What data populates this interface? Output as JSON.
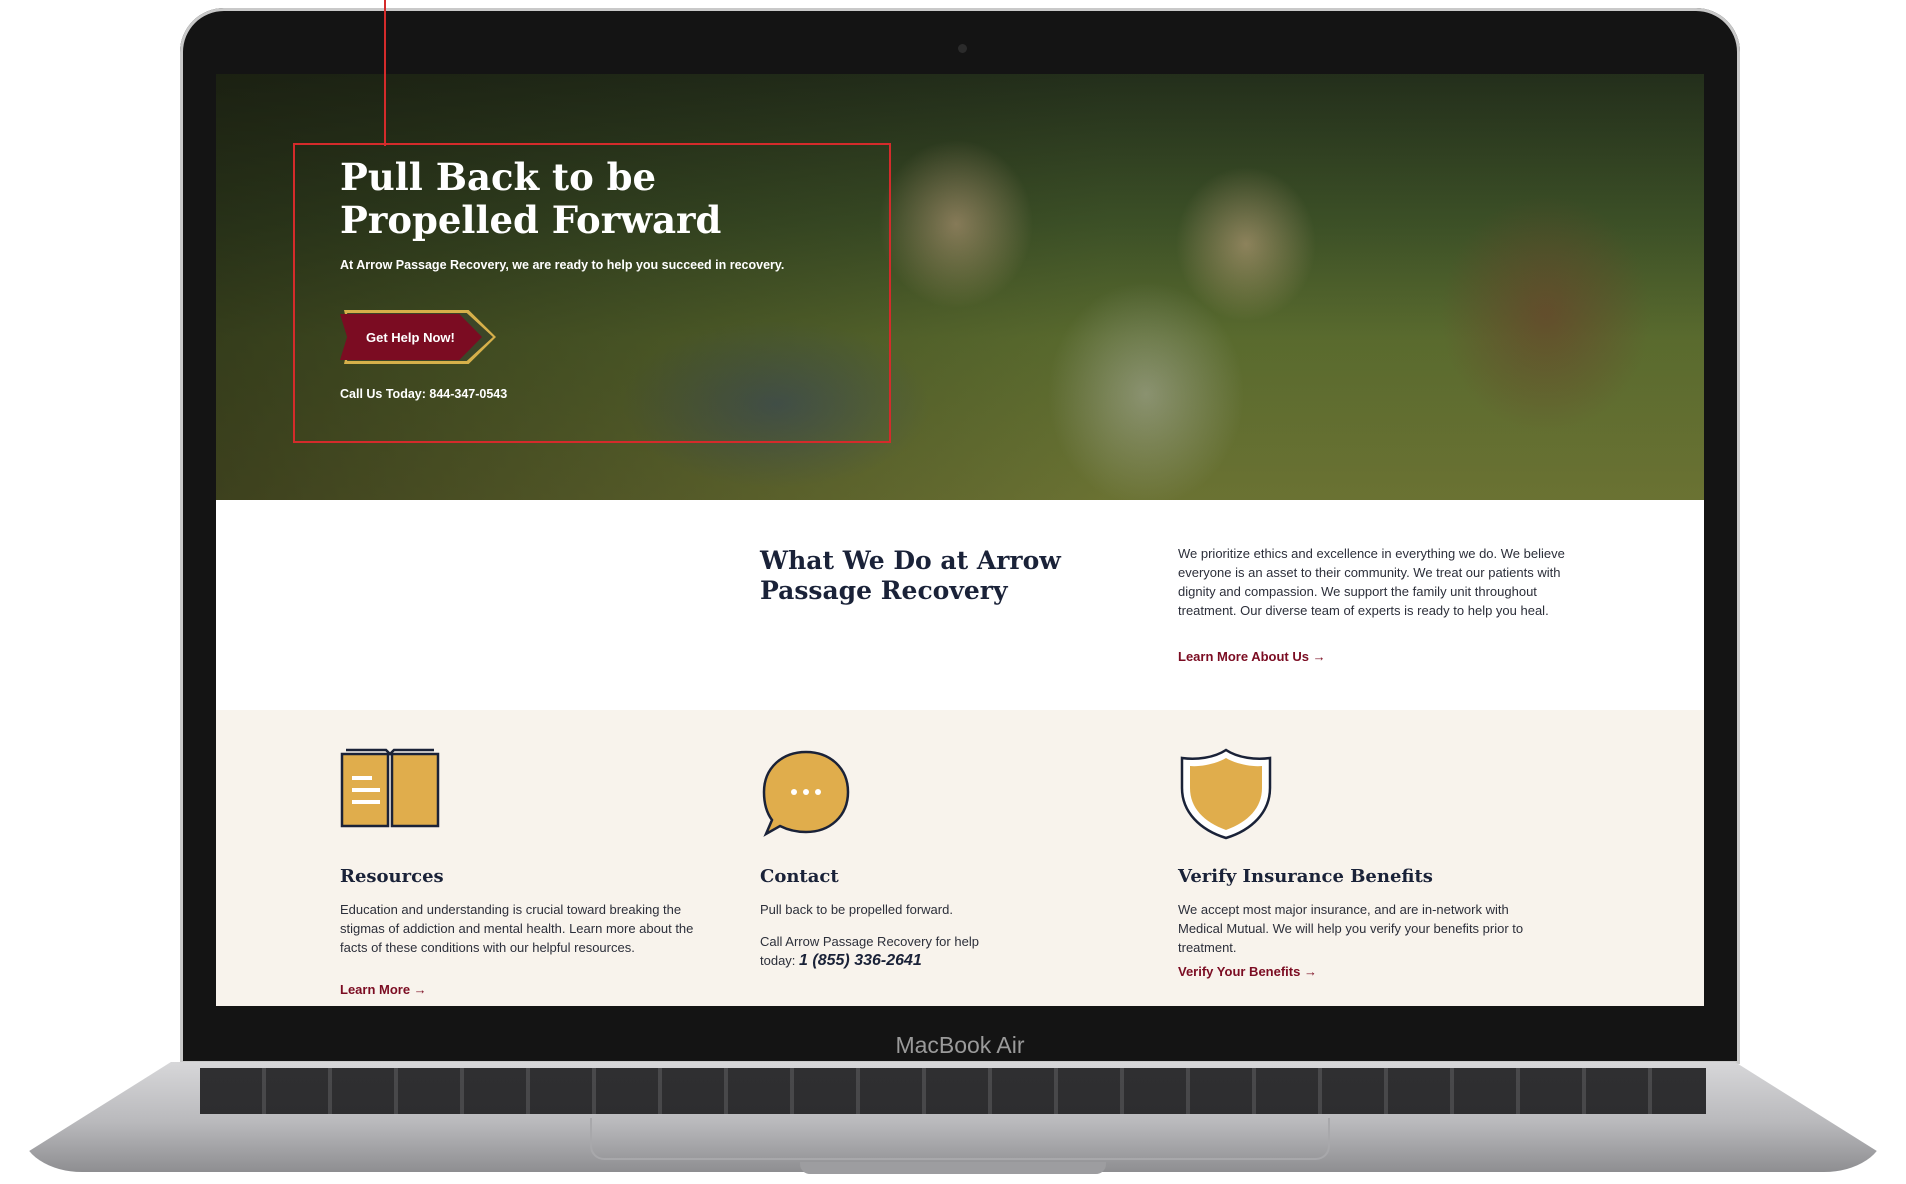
{
  "device": {
    "label": "MacBook Air"
  },
  "hero": {
    "title": "Pull Back to be Propelled Forward",
    "subtitle": "At Arrow Passage Recovery, we are ready to help you succeed in recovery.",
    "cta_label": "Get Help Now!",
    "phone_text": "Call Us Today: 844-347-0543"
  },
  "about": {
    "title": "What We Do at Arrow Passage Recovery",
    "body": "We prioritize ethics and excellence in everything we do. We believe everyone is an asset to their community. We treat our patients with dignity and compassion. We support the family unit throughout treatment. Our diverse team of experts is ready to help you heal.",
    "link": "Learn More About Us →"
  },
  "features": [
    {
      "icon": "book-icon",
      "title": "Resources",
      "text": "Education and understanding is crucial toward breaking the stigmas of addiction and mental health. Learn more about the facts of these conditions with our helpful resources.",
      "link": "Learn More →"
    },
    {
      "icon": "chat-bubble-icon",
      "title": "Contact",
      "text": "Pull back to be propelled forward.",
      "text2": "Call Arrow Passage Recovery for help today:",
      "phone": "1 (855) 336-2641"
    },
    {
      "icon": "shield-icon",
      "title": "Verify Insurance Benefits",
      "text": "We accept most major insurance, and are in-network with Medical Mutual. We will help you verify your benefits prior to treatment.",
      "link": "Verify Your Benefits →"
    }
  ],
  "colors": {
    "brand_red": "#7b0c22",
    "gold": "#e0ad4c",
    "navy": "#1a2238",
    "cream": "#f8f3ec",
    "annotation": "#d42b2b"
  }
}
